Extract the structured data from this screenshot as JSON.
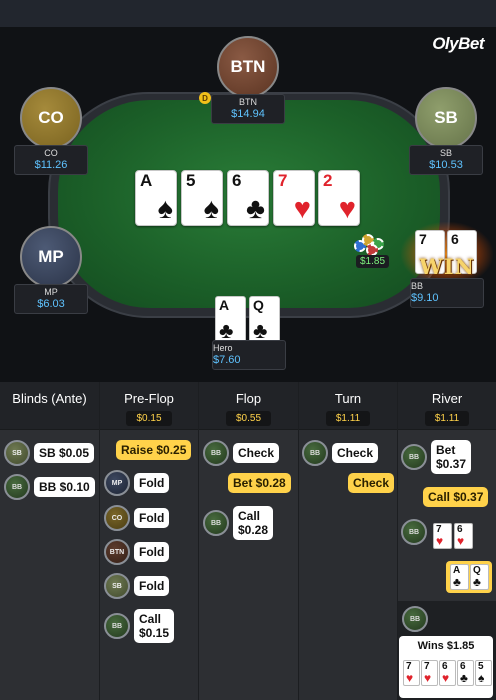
{
  "brand": "OlyBet",
  "seats": {
    "btn": {
      "avatar": "BTN",
      "name": "BTN",
      "stack": "$14.94"
    },
    "co": {
      "avatar": "CO",
      "name": "CO",
      "stack": "$11.26"
    },
    "sb": {
      "avatar": "SB",
      "name": "SB",
      "stack": "$10.53"
    },
    "mp": {
      "avatar": "MP",
      "name": "MP",
      "stack": "$6.03"
    },
    "bb": {
      "name": "BB",
      "stack": "$9.10"
    },
    "hero": {
      "name": "Hero",
      "stack": "$7.60"
    }
  },
  "dealer_button": "D",
  "board": [
    {
      "rank": "A",
      "suit": "♠",
      "color": "#111111"
    },
    {
      "rank": "5",
      "suit": "♠",
      "color": "#111111"
    },
    {
      "rank": "6",
      "suit": "♣",
      "color": "#111111"
    },
    {
      "rank": "7",
      "suit": "♥",
      "color": "#e0232c"
    },
    {
      "rank": "2",
      "suit": "♥",
      "color": "#e0232c"
    }
  ],
  "hero_cards": [
    {
      "rank": "A",
      "suit": "♣"
    },
    {
      "rank": "Q",
      "suit": "♣"
    }
  ],
  "winner_cards": [
    {
      "rank": "7",
      "suit": "♥"
    },
    {
      "rank": "6",
      "suit": "♥"
    }
  ],
  "win_label": "WIN",
  "pot": "$1.85",
  "history": {
    "columns": [
      {
        "name": "Blinds (Ante)",
        "pot": ""
      },
      {
        "name": "Pre-Flop",
        "pot": "$0.15"
      },
      {
        "name": "Flop",
        "pot": "$0.55"
      },
      {
        "name": "Turn",
        "pot": "$1.11"
      },
      {
        "name": "River",
        "pot": "$1.11"
      }
    ],
    "blinds": [
      {
        "pos": "SB",
        "text": "SB $0.05"
      },
      {
        "pos": "BB",
        "text": "BB $0.10"
      }
    ],
    "preflop": {
      "raise": "Raise $0.25",
      "acts": [
        {
          "pos": "MP",
          "text": "Fold"
        },
        {
          "pos": "CO",
          "text": "Fold"
        },
        {
          "pos": "BTN",
          "text": "Fold"
        },
        {
          "pos": "SB",
          "text": "Fold"
        },
        {
          "pos": "BB",
          "text": "Call\n$0.15"
        }
      ]
    },
    "flop": {
      "check": "Check",
      "bet": "Bet $0.28",
      "bb": "BB",
      "call": "Call\n$0.28"
    },
    "turn": {
      "check": "Check",
      "check2": "Check",
      "bb": "BB"
    },
    "river": {
      "bet": "Bet\n$0.37",
      "call": "Call $0.37",
      "bb": "BB",
      "bb_cards": [
        {
          "rank": "7",
          "suit": "♥"
        },
        {
          "rank": "6",
          "suit": "♥"
        }
      ],
      "hero_cards": [
        {
          "rank": "A",
          "suit": "♣"
        },
        {
          "rank": "Q",
          "suit": "♣"
        }
      ],
      "wins": "Wins $1.85",
      "win_cards": [
        {
          "rank": "7",
          "suit": "♥"
        },
        {
          "rank": "7",
          "suit": "♥"
        },
        {
          "rank": "6",
          "suit": "♥"
        },
        {
          "rank": "6",
          "suit": "♣"
        },
        {
          "rank": "5",
          "suit": "♠"
        }
      ]
    }
  }
}
